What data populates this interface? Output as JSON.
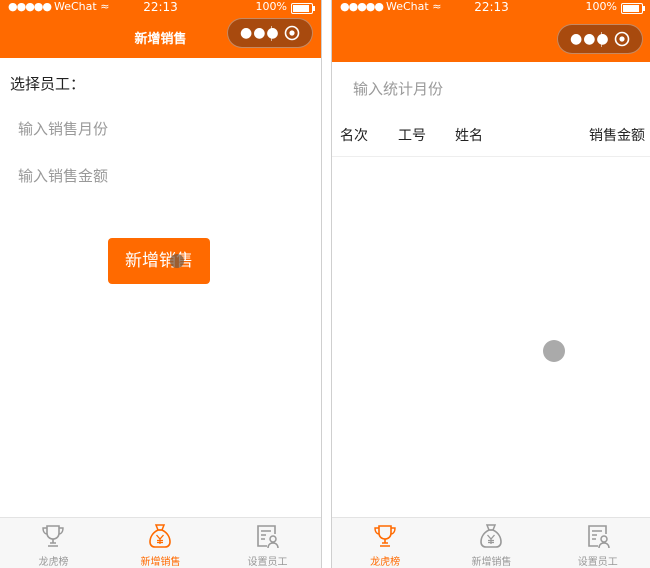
{
  "colors": {
    "accent": "#ff6a00",
    "capsule": "#a84a0e",
    "muted_text": "#999999",
    "tab_inactive": "#999999"
  },
  "statusbar": {
    "carrier": "WeChat",
    "time": "22:13",
    "battery": "100%"
  },
  "left_screen": {
    "nav_title": "新增销售",
    "employee_label": "选择员工：",
    "month_placeholder": "输入销售月份",
    "amount_placeholder": "输入销售金额",
    "submit_label": "新增销售"
  },
  "right_screen": {
    "nav_title": "",
    "month_placeholder": "输入统计月份",
    "columns": [
      "名次",
      "工号",
      "姓名",
      "销售金额"
    ]
  },
  "tabbar": {
    "tabs": [
      {
        "label": "龙虎榜",
        "icon": "trophy-icon"
      },
      {
        "label": "新增销售",
        "icon": "money-bag-icon"
      },
      {
        "label": "设置员工",
        "icon": "staff-card-icon"
      }
    ]
  }
}
